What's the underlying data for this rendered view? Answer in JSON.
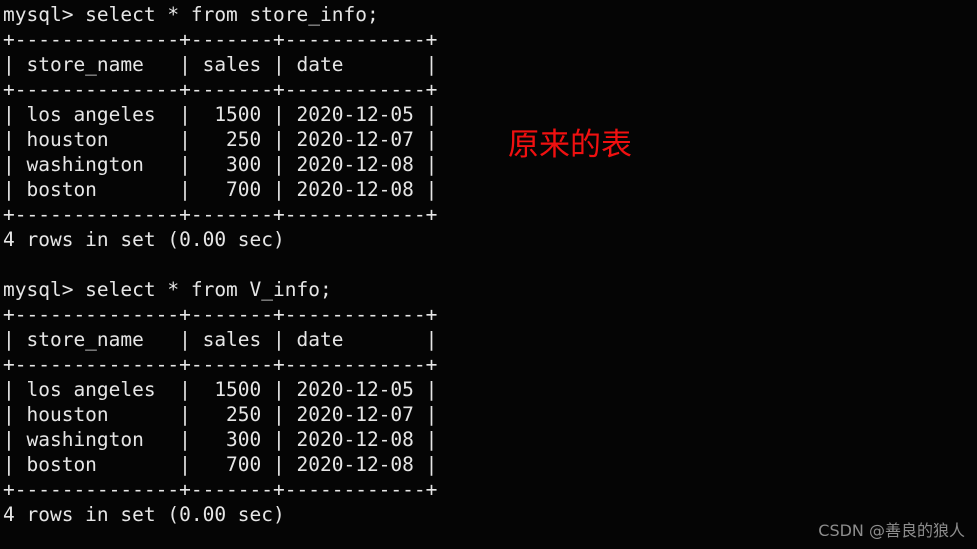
{
  "terminal": {
    "background_color": "#050505",
    "text_color": "#e6e6e6",
    "lines": [
      "mysql> select * from store_info;",
      "+--------------+-------+------------+",
      "| store_name   | sales | date       |",
      "+--------------+-------+------------+",
      "| los angeles  |  1500 | 2020-12-05 |",
      "| houston      |   250 | 2020-12-07 |",
      "| washington   |   300 | 2020-12-08 |",
      "| boston       |   700 | 2020-12-08 |",
      "+--------------+-------+------------+",
      "4 rows in set (0.00 sec)",
      "",
      "mysql> select * from V_info;",
      "+--------------+-------+------------+",
      "| store_name   | sales | date       |",
      "+--------------+-------+------------+",
      "| los angeles  |  1500 | 2020-12-05 |",
      "| houston      |   250 | 2020-12-07 |",
      "| washington   |   300 | 2020-12-08 |",
      "| boston       |   700 | 2020-12-08 |",
      "+--------------+-------+------------+",
      "4 rows in set (0.00 sec)"
    ],
    "queries": [
      {
        "prompt": "mysql>",
        "statement": "select * from store_info;",
        "result_status": "4 rows in set (0.00 sec)",
        "columns": [
          "store_name",
          "sales",
          "date"
        ],
        "rows": [
          [
            "los angeles",
            "1500",
            "2020-12-05"
          ],
          [
            "houston",
            "250",
            "2020-12-07"
          ],
          [
            "washington",
            "300",
            "2020-12-08"
          ],
          [
            "boston",
            "700",
            "2020-12-08"
          ]
        ]
      },
      {
        "prompt": "mysql>",
        "statement": "select * from V_info;",
        "result_status": "4 rows in set (0.00 sec)",
        "columns": [
          "store_name",
          "sales",
          "date"
        ],
        "rows": [
          [
            "los angeles",
            "1500",
            "2020-12-05"
          ],
          [
            "houston",
            "250",
            "2020-12-07"
          ],
          [
            "washington",
            "300",
            "2020-12-08"
          ],
          [
            "boston",
            "700",
            "2020-12-08"
          ]
        ]
      }
    ]
  },
  "annotation": {
    "text": "原来的表",
    "color": "#f01010"
  },
  "watermark": {
    "text": "CSDN @善良的狼人",
    "color": "#8d8d8d"
  }
}
